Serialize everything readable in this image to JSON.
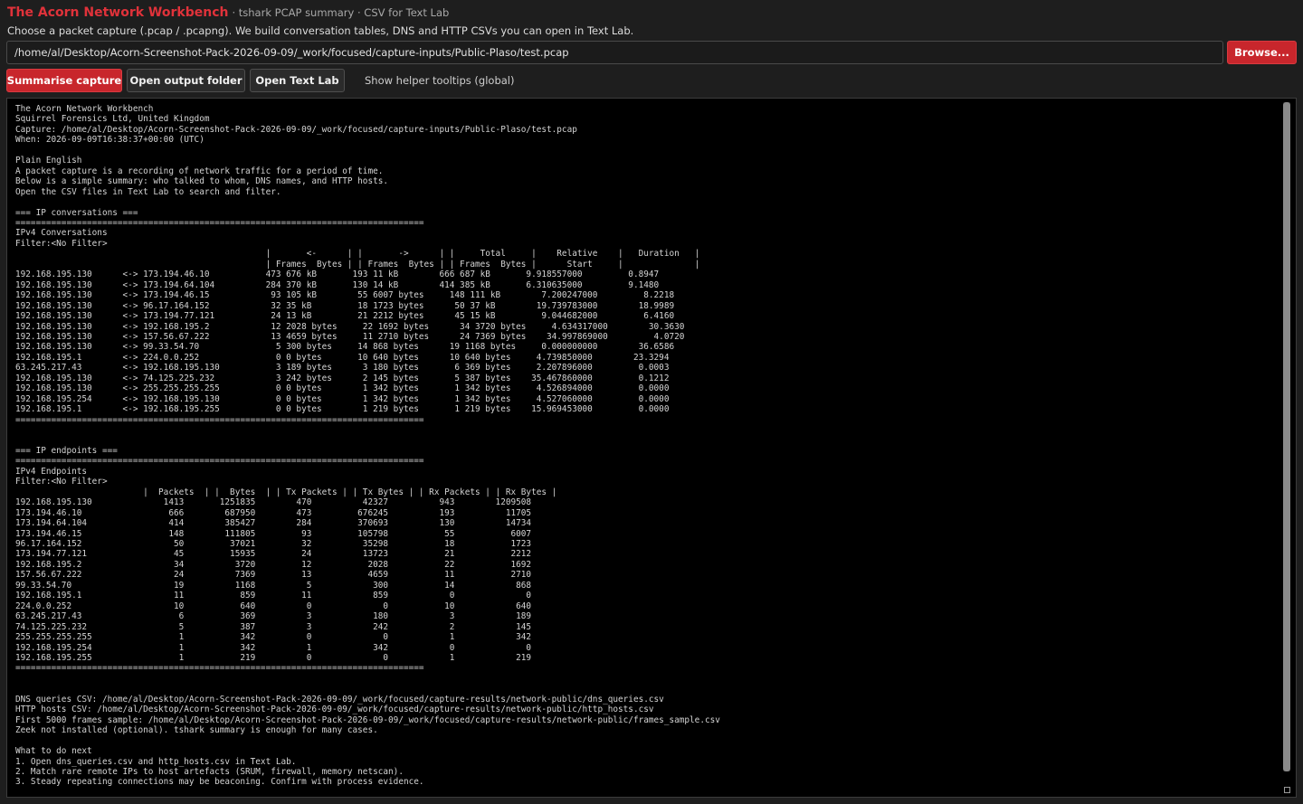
{
  "header": {
    "title": "The Acorn Network Workbench",
    "subtitle": "· tshark PCAP summary · CSV for Text Lab"
  },
  "intro": "Choose a packet capture (.pcap / .pcapng). We build conversation tables, DNS and HTTP CSVs you can open in Text Lab.",
  "path_input": {
    "value": "/home/al/Desktop/Acorn-Screenshot-Pack-2026-09-09/_work/focused/capture-inputs/Public-Plaso/test.pcap"
  },
  "buttons": {
    "browse": "Browse...",
    "summarise": "Summarise capture",
    "open_folder": "Open output folder",
    "open_textlab": "Open Text Lab"
  },
  "tooltip_toggle": "Show helper tooltips (global)",
  "output": {
    "lines": [
      "The Acorn Network Workbench",
      "Squirrel Forensics Ltd, United Kingdom",
      "Capture: /home/al/Desktop/Acorn-Screenshot-Pack-2026-09-09/_work/focused/capture-inputs/Public-Plaso/test.pcap",
      "When: 2026-09-09T16:38:37+00:00 (UTC)",
      "",
      "Plain English",
      "A packet capture is a recording of network traffic for a period of time.",
      "Below is a simple summary: who talked to whom, DNS names, and HTTP hosts.",
      "Open the CSV files in Text Lab to search and filter.",
      "",
      "=== IP conversations ===",
      "================================================================================",
      "IPv4 Conversations",
      "Filter:<No Filter>",
      "                                                 |       <-      | |       ->      | |     Total     |    Relative    |   Duration   |",
      "                                                 | Frames  Bytes | | Frames  Bytes | | Frames  Bytes |      Start     |              |",
      "192.168.195.130      <-> 173.194.46.10           473 676 kB       193 11 kB        666 687 kB       9.918557000         0.8947",
      "192.168.195.130      <-> 173.194.64.104          284 370 kB       130 14 kB        414 385 kB       6.310635000         9.1480",
      "192.168.195.130      <-> 173.194.46.15            93 105 kB        55 6007 bytes     148 111 kB        7.200247000         8.2218",
      "192.168.195.130      <-> 96.17.164.152            32 35 kB         18 1723 bytes      50 37 kB        19.739783000        18.9989",
      "192.168.195.130      <-> 173.194.77.121           24 13 kB         21 2212 bytes      45 15 kB         9.044682000         6.4160",
      "192.168.195.130      <-> 192.168.195.2            12 2028 bytes     22 1692 bytes      34 3720 bytes     4.634317000        30.3630",
      "192.168.195.130      <-> 157.56.67.222            13 4659 bytes     11 2710 bytes      24 7369 bytes    34.997869000         4.0720",
      "192.168.195.130      <-> 99.33.54.70               5 300 bytes     14 868 bytes      19 1168 bytes     0.000000000        36.6586",
      "192.168.195.1        <-> 224.0.0.252               0 0 bytes       10 640 bytes      10 640 bytes     4.739850000        23.3294",
      "63.245.217.43        <-> 192.168.195.130           3 189 bytes      3 180 bytes       6 369 bytes     2.207896000         0.0003",
      "192.168.195.130      <-> 74.125.225.232            3 242 bytes      2 145 bytes       5 387 bytes    35.467860000         0.1212",
      "192.168.195.130      <-> 255.255.255.255           0 0 bytes        1 342 bytes       1 342 bytes     4.526894000         0.0000",
      "192.168.195.254      <-> 192.168.195.130           0 0 bytes        1 342 bytes       1 342 bytes     4.527060000         0.0000",
      "192.168.195.1        <-> 192.168.195.255           0 0 bytes        1 219 bytes       1 219 bytes    15.969453000         0.0000",
      "================================================================================",
      "",
      "",
      "=== IP endpoints ===",
      "================================================================================",
      "IPv4 Endpoints",
      "Filter:<No Filter>",
      "                         |  Packets  | |  Bytes  | | Tx Packets | | Tx Bytes | | Rx Packets | | Rx Bytes |",
      "192.168.195.130              1413       1251835        470          42327          943        1209508",
      "173.194.46.10                 666        687950        473         676245          193          11705",
      "173.194.64.104                414        385427        284         370693          130          14734",
      "173.194.46.15                 148        111805         93         105798           55           6007",
      "96.17.164.152                  50         37021         32          35298           18           1723",
      "173.194.77.121                 45         15935         24          13723           21           2212",
      "192.168.195.2                  34          3720         12           2028           22           1692",
      "157.56.67.222                  24          7369         13           4659           11           2710",
      "99.33.54.70                    19          1168          5            300           14            868",
      "192.168.195.1                  11           859         11            859            0              0",
      "224.0.0.252                    10           640          0              0           10            640",
      "63.245.217.43                   6           369          3            180            3            189",
      "74.125.225.232                  5           387          3            242            2            145",
      "255.255.255.255                 1           342          0              0            1            342",
      "192.168.195.254                 1           342          1            342            0              0",
      "192.168.195.255                 1           219          0              0            1            219",
      "================================================================================",
      "",
      "",
      "DNS queries CSV: /home/al/Desktop/Acorn-Screenshot-Pack-2026-09-09/_work/focused/capture-results/network-public/dns_queries.csv",
      "HTTP hosts CSV: /home/al/Desktop/Acorn-Screenshot-Pack-2026-09-09/_work/focused/capture-results/network-public/http_hosts.csv",
      "First 5000 frames sample: /home/al/Desktop/Acorn-Screenshot-Pack-2026-09-09/_work/focused/capture-results/network-public/frames_sample.csv",
      "Zeek not installed (optional). tshark summary is enough for many cases.",
      "",
      "What to do next",
      "1. Open dns_queries.csv and http_hosts.csv in Text Lab.",
      "2. Match rare remote IPs to host artefacts (SRUM, firewall, memory netscan).",
      "3. Steady repeating connections may be beaconing. Confirm with process evidence."
    ]
  }
}
